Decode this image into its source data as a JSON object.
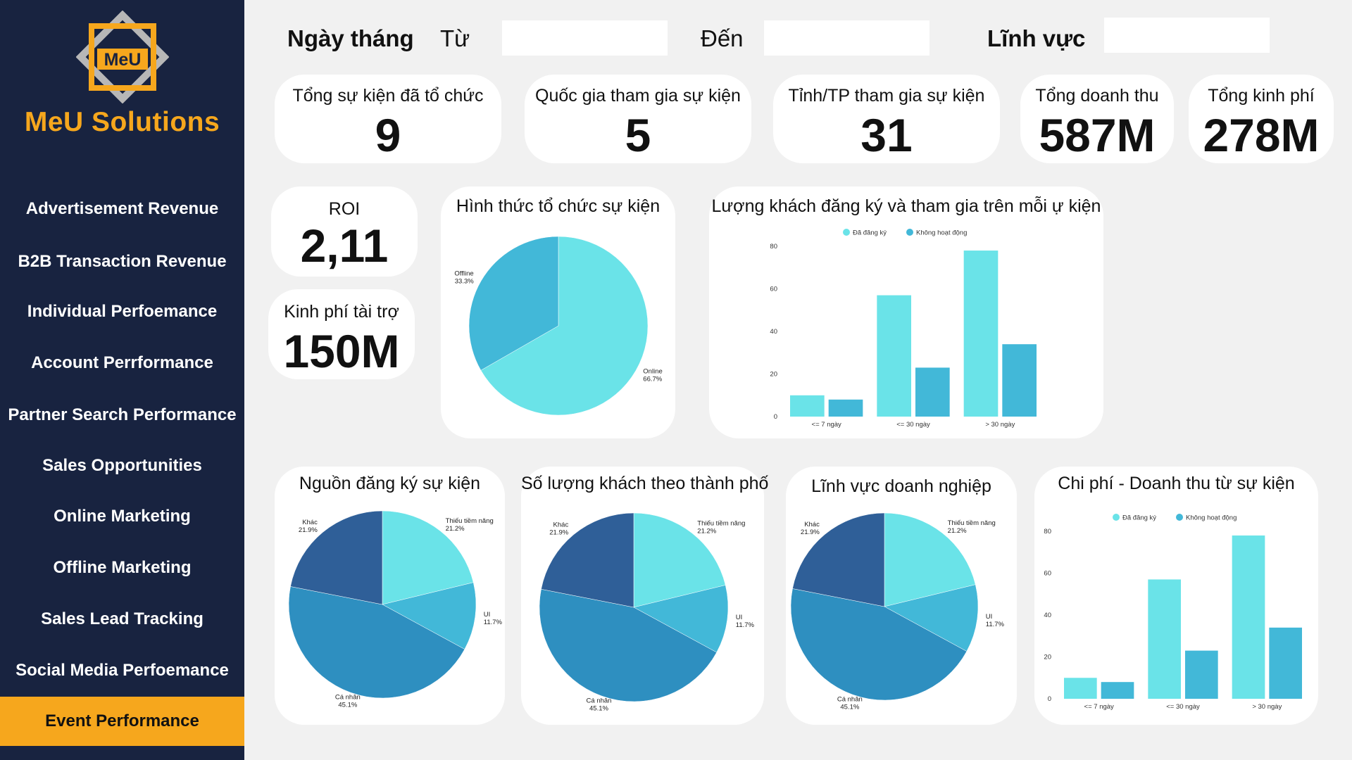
{
  "brand": {
    "name": "MeU Solutions",
    "logo_text": "MeU"
  },
  "colors": {
    "sidebar": "#182340",
    "accent": "#f6a71d",
    "c1": "#6ae3e8",
    "c2": "#42b8d8",
    "c3": "#2e8fc0",
    "c4": "#2f5f98"
  },
  "sidebar": {
    "items": [
      {
        "label": "Advertisement Revenue"
      },
      {
        "label": "B2B Transaction Revenue"
      },
      {
        "label": "Individual Perfoemance"
      },
      {
        "label": "Account Perrformance"
      },
      {
        "label": "Partner Search Performance"
      },
      {
        "label": "Sales Opportunities"
      },
      {
        "label": "Online Marketing"
      },
      {
        "label": "Offline Marketing"
      },
      {
        "label": "Sales Lead Tracking"
      },
      {
        "label": "Social Media Perfoemance"
      },
      {
        "label": "Event Performance",
        "active": true
      }
    ]
  },
  "filters": {
    "date_label": "Ngày tháng",
    "from_label": "Từ",
    "to_label": "Đến",
    "field_label": "Lĩnh vực",
    "from_value": "",
    "to_value": "",
    "field_value": ""
  },
  "kpis": {
    "events": {
      "title": "Tổng sự kiện đã tổ chức",
      "value": "9"
    },
    "countries": {
      "title": "Quốc gia tham gia sự kiện",
      "value": "5"
    },
    "provinces": {
      "title": "Tỉnh/TP tham gia sự kiện",
      "value": "31"
    },
    "revenue": {
      "title": "Tổng doanh thu",
      "value": "587M"
    },
    "cost": {
      "title": "Tổng kinh phí",
      "value": "278M"
    },
    "roi": {
      "title": "ROI",
      "value": "2,11"
    },
    "sponsor": {
      "title": "Kinh phí tài trợ",
      "value": "150M"
    }
  },
  "chart_data": [
    {
      "id": "format",
      "type": "pie",
      "title": "Hình thức tổ chức sự kiện",
      "slices": [
        {
          "label": "Online",
          "value": 66.7,
          "pct": "66.7%",
          "color": "#6ae3e8"
        },
        {
          "label": "Offline",
          "value": 33.3,
          "pct": "33.3%",
          "color": "#42b8d8"
        }
      ]
    },
    {
      "id": "guests",
      "type": "bar",
      "title": "Lượng khách đăng ký và tham gia trên mỗi ự kiện",
      "categories": [
        "<= 7 ngày",
        "<= 30 ngày",
        "> 30 ngày"
      ],
      "series": [
        {
          "name": "Đã đăng ký",
          "values": [
            10,
            57,
            78
          ],
          "color": "#6ae3e8"
        },
        {
          "name": "Không hoạt động",
          "values": [
            8,
            23,
            34
          ],
          "color": "#42b8d8"
        }
      ],
      "ylim": [
        0,
        80
      ],
      "yticks": [
        0,
        20,
        40,
        60,
        80
      ],
      "legend": "top"
    },
    {
      "id": "source",
      "type": "pie",
      "title": "Nguồn đăng ký sự kiện",
      "slices": [
        {
          "label": "Thiếu tiềm năng",
          "value": 21.2,
          "pct": "21.2%",
          "color": "#6ae3e8"
        },
        {
          "label": "UI",
          "value": 11.7,
          "pct": "11.7%",
          "color": "#42b8d8"
        },
        {
          "label": "Cá nhân",
          "value": 45.1,
          "pct": "45.1%",
          "color": "#2e8fc0"
        },
        {
          "label": "Khác",
          "value": 21.9,
          "pct": "21.9%",
          "color": "#2f5f98"
        }
      ]
    },
    {
      "id": "city",
      "type": "pie",
      "title": "Số lượng khách theo thành phố",
      "slices": [
        {
          "label": "Thiếu tiềm năng",
          "value": 21.2,
          "pct": "21.2%",
          "color": "#6ae3e8"
        },
        {
          "label": "UI",
          "value": 11.7,
          "pct": "11.7%",
          "color": "#42b8d8"
        },
        {
          "label": "Cá nhân",
          "value": 45.1,
          "pct": "45.1%",
          "color": "#2e8fc0"
        },
        {
          "label": "Khác",
          "value": 21.9,
          "pct": "21.9%",
          "color": "#2f5f98"
        }
      ]
    },
    {
      "id": "industry",
      "type": "pie",
      "title": "Lĩnh vực doanh nghiệp",
      "slices": [
        {
          "label": "Thiếu tiềm năng",
          "value": 21.2,
          "pct": "21.2%",
          "color": "#6ae3e8"
        },
        {
          "label": "UI",
          "value": 11.7,
          "pct": "11.7%",
          "color": "#42b8d8"
        },
        {
          "label": "Cá nhân",
          "value": 45.1,
          "pct": "45.1%",
          "color": "#2e8fc0"
        },
        {
          "label": "Khác",
          "value": 21.9,
          "pct": "21.9%",
          "color": "#2f5f98"
        }
      ]
    },
    {
      "id": "costrev",
      "type": "bar",
      "title": "Chi phí - Doanh thu từ sự kiện",
      "categories": [
        "<= 7 ngày",
        "<= 30 ngày",
        "> 30 ngày"
      ],
      "series": [
        {
          "name": "Đã đăng ký",
          "values": [
            10,
            57,
            78
          ],
          "color": "#6ae3e8"
        },
        {
          "name": "Không hoạt động",
          "values": [
            8,
            23,
            34
          ],
          "color": "#42b8d8"
        }
      ],
      "ylim": [
        0,
        80
      ],
      "yticks": [
        0,
        20,
        40,
        60,
        80
      ],
      "legend": "top"
    }
  ]
}
